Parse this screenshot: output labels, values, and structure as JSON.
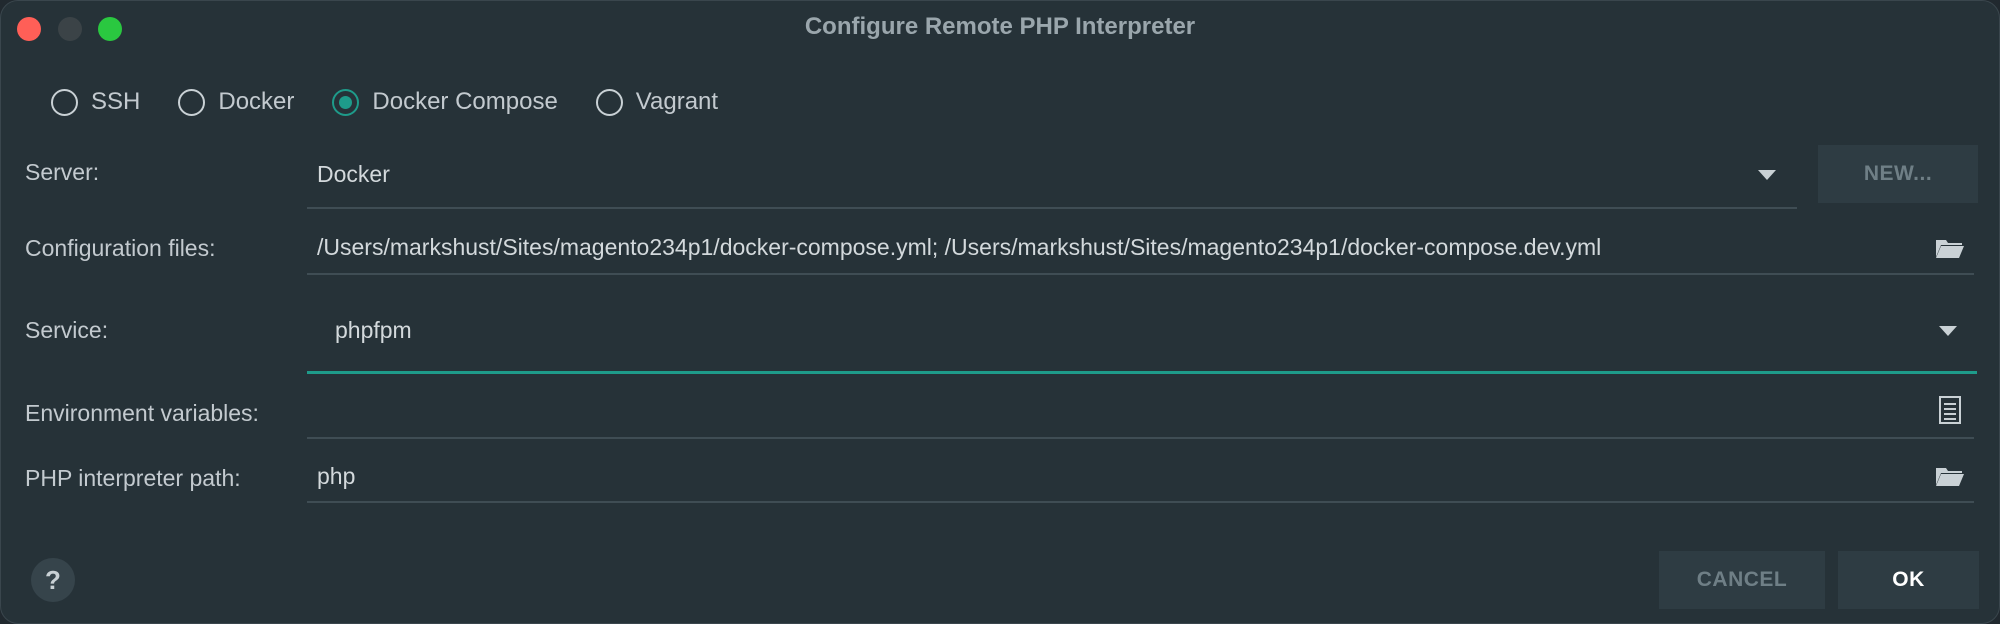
{
  "window": {
    "title": "Configure Remote PHP Interpreter"
  },
  "connection_types": {
    "options": [
      "SSH",
      "Docker",
      "Docker Compose",
      "Vagrant"
    ],
    "selected": "Docker Compose"
  },
  "form": {
    "server": {
      "label": "Server:",
      "value": "Docker"
    },
    "new_button": "NEW...",
    "config_files": {
      "label": "Configuration files:",
      "value": "/Users/markshust/Sites/magento234p1/docker-compose.yml; /Users/markshust/Sites/magento234p1/docker-compose.dev.yml"
    },
    "service": {
      "label": "Service:",
      "value": "phpfpm"
    },
    "env_vars": {
      "label": "Environment variables:",
      "value": ""
    },
    "php_path": {
      "label": "PHP interpreter path:",
      "value": "php"
    }
  },
  "footer": {
    "help": "?",
    "cancel": "CANCEL",
    "ok": "OK"
  },
  "icons": {
    "folder": "folder-icon",
    "document": "document-icon",
    "dropdown": "chevron-down-icon"
  },
  "colors": {
    "accent": "#1e9b8a",
    "background": "#263238"
  }
}
